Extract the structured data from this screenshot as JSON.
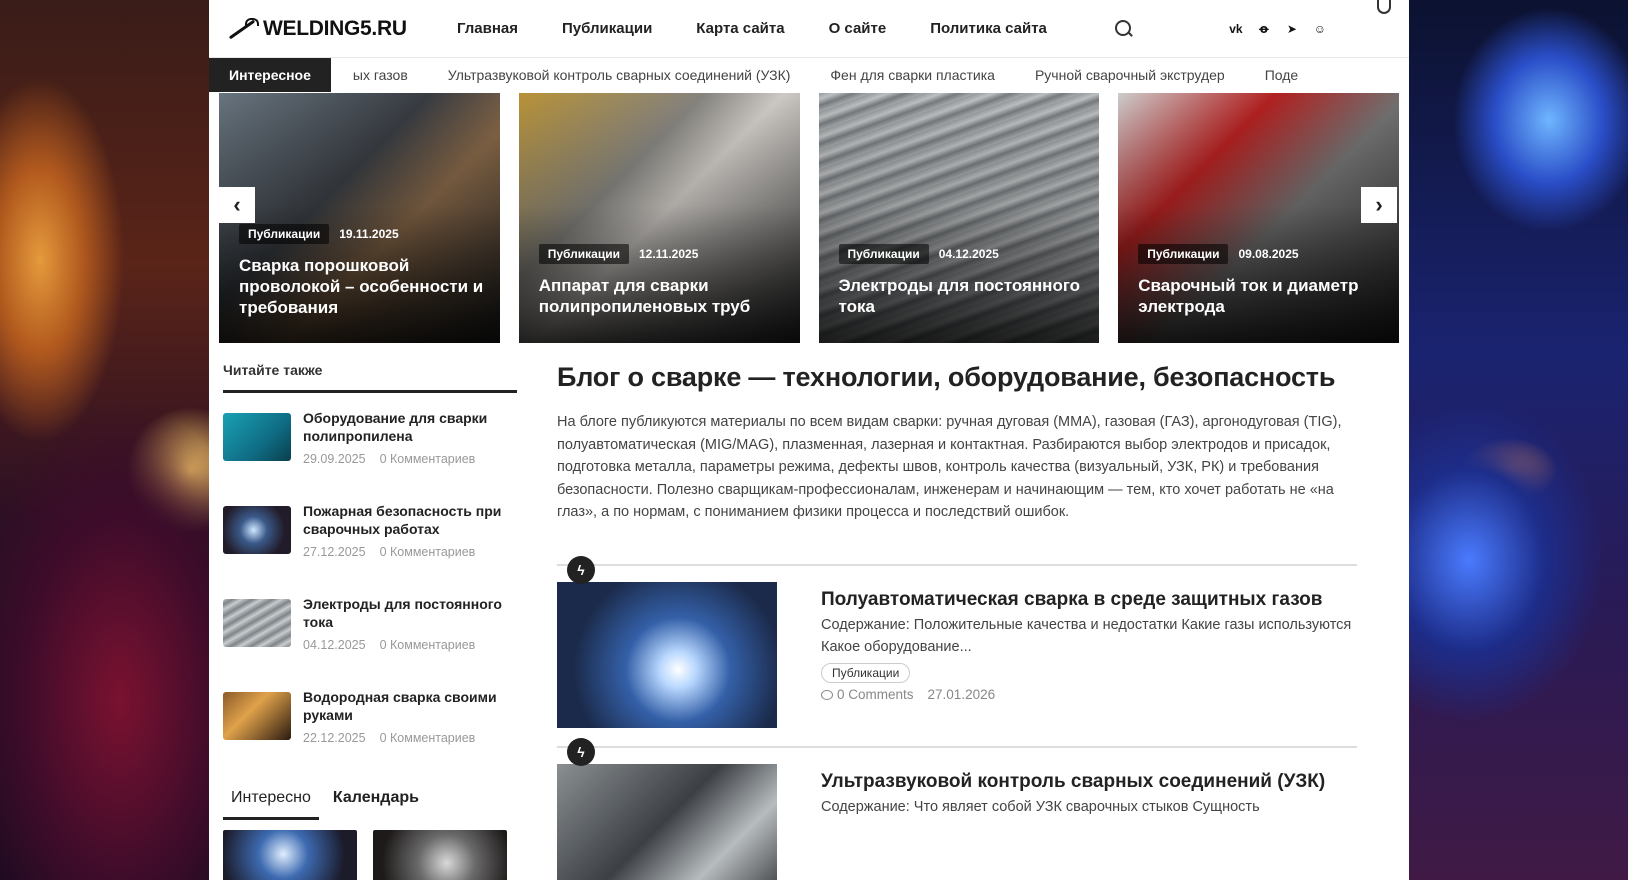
{
  "header": {
    "logo_text": "WELDING5.RU",
    "nav": [
      "Главная",
      "Публикации",
      "Карта сайта",
      "О сайте",
      "Политика сайта"
    ],
    "social": [
      "vk",
      "ok",
      "telegram",
      "dzen"
    ]
  },
  "ticker": {
    "label": "Интересное",
    "items": [
      "ых газов",
      "Ультразвуковой контроль сварных соединений (УЗК)",
      "Фен для сварки пластика",
      "Ручной сварочный экструдер",
      "Поде"
    ]
  },
  "slider": {
    "prev": "‹",
    "next": "›",
    "slides": [
      {
        "category": "Публикации",
        "date": "19.11.2025",
        "title": "Сварка порошковой проволокой – особенности и требования"
      },
      {
        "category": "Публикации",
        "date": "12.11.2025",
        "title": "Аппарат для сварки полипропиленовых труб"
      },
      {
        "category": "Публикации",
        "date": "04.12.2025",
        "title": "Электроды для постоянного тока"
      },
      {
        "category": "Публикации",
        "date": "09.08.2025",
        "title": "Сварочный ток и диаметр электрода"
      }
    ]
  },
  "sidebar": {
    "heading": "Читайте также",
    "items": [
      {
        "title": "Оборудование для сварки полипропилена",
        "date": "29.09.2025",
        "comments": "0 Комментариев"
      },
      {
        "title": "Пожарная безопасность при сварочных работах",
        "date": "27.12.2025",
        "comments": "0 Комментариев"
      },
      {
        "title": "Электроды для постоянного тока",
        "date": "04.12.2025",
        "comments": "0 Комментариев"
      },
      {
        "title": "Водородная сварка своими руками",
        "date": "22.12.2025",
        "comments": "0 Комментариев"
      }
    ],
    "tabs": [
      "Интересно",
      "Календарь"
    ]
  },
  "main": {
    "title": "Блог о сварке — технологии, оборудование, безопасность",
    "description": "На блоге публикуются материалы по всем видам сварки: ручная дуговая (ММА), газовая (ГАЗ), аргонодуговая (TIG), полуавтоматическая (MIG/MAG), плазменная, лазерная и контактная. Разбираются выбор электродов и присадок, подготовка металла, параметры режима, дефекты швов, контроль качества (визуальный, УЗК, РК) и требования безопасности. Полезно сварщикам-профессионалам, инженерам и начинающим — тем, кто хочет работать не «на глаз», а по нормам, с пониманием физики процесса и последствий ошибок.",
    "posts": [
      {
        "title": "Полуавтоматическая сварка в среде защитных газов",
        "excerpt": "Содержание: Положительные качества и недостатки Какие газы используются Какое оборудование...",
        "tag": "Публикации",
        "comments": "0 Comments",
        "date": "27.01.2026"
      },
      {
        "title": "Ультразвуковой контроль сварных соединений (УЗК)",
        "excerpt": "Содержание: Что являет собой УЗК сварочных стыков Сущность"
      }
    ]
  }
}
